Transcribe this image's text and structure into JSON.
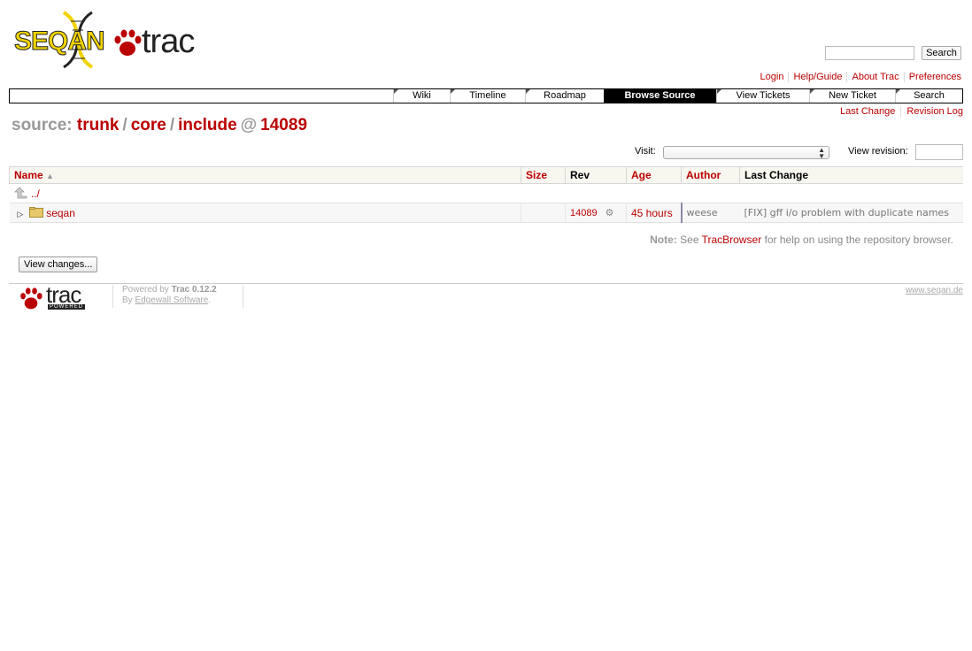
{
  "logo": {
    "name": "SEQAN",
    "product": "trac"
  },
  "search": {
    "button_label": "Search",
    "placeholder": "",
    "value": ""
  },
  "metanav": [
    "Login",
    "Help/Guide",
    "About Trac",
    "Preferences"
  ],
  "mainnav": {
    "tabs": [
      "Wiki",
      "Timeline",
      "Roadmap",
      "Browse Source",
      "View Tickets",
      "New Ticket",
      "Search"
    ],
    "active": "Browse Source"
  },
  "ctxtnav": [
    "Last Change",
    "Revision Log"
  ],
  "path": {
    "prefix": "source:",
    "parts": [
      "trunk",
      "core",
      "include"
    ],
    "rev": "14089"
  },
  "visit": {
    "label": "Visit:",
    "selected": ""
  },
  "view_revision": {
    "label": "View revision:",
    "value": ""
  },
  "table": {
    "headers": {
      "name": "Name",
      "size": "Size",
      "rev": "Rev",
      "age": "Age",
      "author": "Author",
      "change": "Last Change"
    },
    "sort_indicator": "▲",
    "parent": "../",
    "rows": [
      {
        "name": "seqan",
        "size": "",
        "rev": "14089",
        "age": "45 hours",
        "author": "weese",
        "change": "[FIX] gff i/o problem with duplicate names"
      }
    ]
  },
  "note": {
    "label": "Note:",
    "pre": "See",
    "link": "TracBrowser",
    "post": "for help on using the repository browser."
  },
  "view_changes_label": "View changes...",
  "footer": {
    "logo_text": "trac",
    "logo_badge": "POWERED",
    "powered_by": "Powered by",
    "trac_version": "Trac 0.12.2",
    "by": "By",
    "company": "Edgewall Software",
    "site": "www.seqan.de"
  }
}
